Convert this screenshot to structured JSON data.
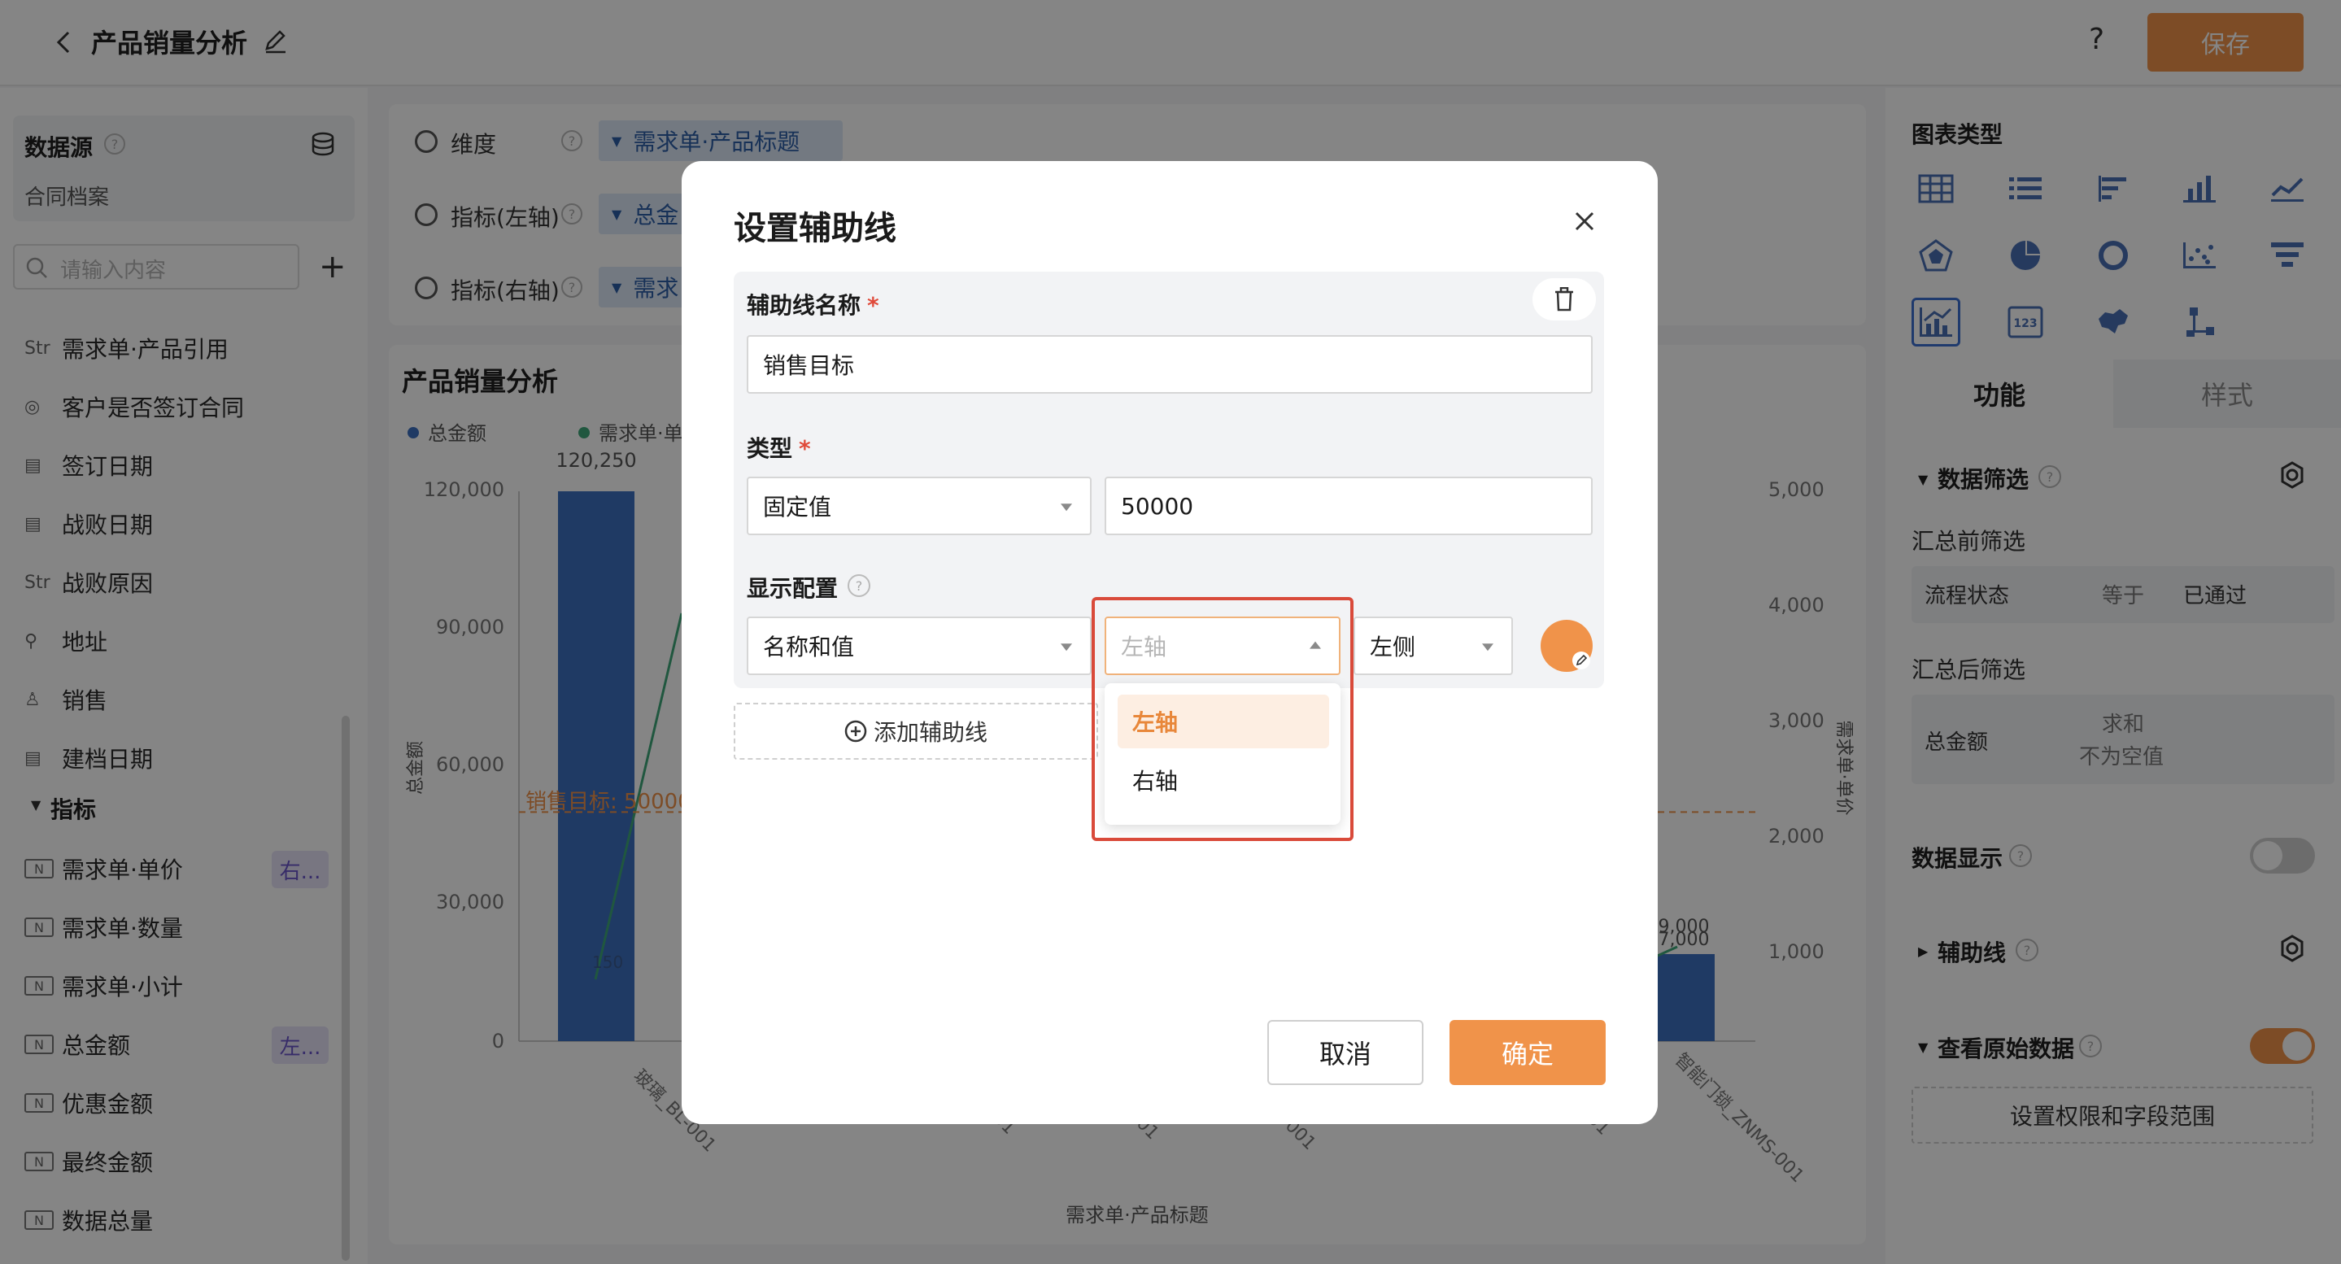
{
  "header": {
    "title": "产品销量分析",
    "help": "?",
    "save_label": "保存"
  },
  "datasource": {
    "title": "数据源",
    "help": "?",
    "name": "合同档案",
    "search_placeholder": "请输入内容",
    "fields": [
      {
        "icon": "Str",
        "label": "需求单·产品引用"
      },
      {
        "icon": "◎",
        "label": "客户是否签订合同"
      },
      {
        "icon": "▤",
        "label": "签订日期"
      },
      {
        "icon": "▤",
        "label": "战败日期"
      },
      {
        "icon": "Str",
        "label": "战败原因"
      },
      {
        "icon": "⚲",
        "label": "地址"
      },
      {
        "icon": "♙",
        "label": "销售"
      },
      {
        "icon": "▤",
        "label": "建档日期"
      }
    ],
    "metric_section": "指标",
    "metrics": [
      {
        "label": "需求单·单价",
        "badge": "右..."
      },
      {
        "label": "需求单·数量",
        "badge": ""
      },
      {
        "label": "需求单·小计",
        "badge": ""
      },
      {
        "label": "总金额",
        "badge": "左..."
      },
      {
        "label": "优惠金额",
        "badge": ""
      },
      {
        "label": "最终金额",
        "badge": ""
      },
      {
        "label": "数据总量",
        "badge": ""
      }
    ]
  },
  "config_rows": [
    {
      "label": "维度",
      "tag": "需求单·产品标题"
    },
    {
      "label": "指标(左轴)",
      "tag": "总金"
    },
    {
      "label": "指标(右轴)",
      "tag": "需求"
    }
  ],
  "chart": {
    "title": "产品销量分析",
    "legend": [
      "总金额",
      "需求单·单"
    ],
    "top_label": "120,250",
    "left_ticks": [
      "120,000",
      "90,000",
      "60,000",
      "30,000",
      "0"
    ],
    "right_ticks": [
      "5,000",
      "4,000",
      "3,000",
      "2,000",
      "1,000"
    ],
    "left_axis_title": "总金额",
    "right_axis_title": "需求单·单价",
    "x_axis_title": "需求单·产品标题",
    "x_labels": [
      "玻璃_BL-001",
      "001",
      "DZYJ-001",
      "SQ-001",
      "LYYX-001",
      "001",
      "SLKL-001",
      "智能门锁_ZNMS-001"
    ],
    "aux_label": "销售目标: 50000",
    "bar_partial_labels": [
      "9,000",
      "7,000"
    ],
    "line_point_label": "150",
    "colors": {
      "bar": "#3d6fc0",
      "line": "#3ea87a",
      "aux": "#f0934a"
    }
  },
  "chart_data": {
    "type": "bar",
    "title": "产品销量分析",
    "xlabel": "需求单·产品标题",
    "ylabel": "总金额",
    "ylim": [
      0,
      120000
    ],
    "y2label": "需求单·单价",
    "y2lim": [
      0,
      5000
    ],
    "categories": [
      "玻璃_BL-001",
      "智能门锁_ZNMS-001"
    ],
    "series": [
      {
        "name": "总金额",
        "values": [
          120250,
          19000
        ]
      }
    ],
    "reference_line": {
      "name": "销售目标",
      "value": 50000
    }
  },
  "right_panel": {
    "chart_type_title": "图表类型",
    "chart_type_icons": [
      "table-icon",
      "list-icon",
      "bar-horizontal-icon",
      "bar-icon",
      "line-icon",
      "radar-icon",
      "pie-icon",
      "ring-icon",
      "scatter-icon",
      "funnel-icon",
      "combo-chart-icon",
      "number-card-icon",
      "map-icon",
      "tree-icon"
    ],
    "tab_func": "功能",
    "tab_style": "样式",
    "data_filter": "数据筛选",
    "pre_filter": "汇总前筛选",
    "pre_filter_field": "流程状态",
    "pre_filter_op": "等于",
    "pre_filter_value": "已通过",
    "post_filter": "汇总后筛选",
    "post_filter_field": "总金额",
    "post_filter_op_line1": "求和",
    "post_filter_op_line2": "不为空值",
    "data_display": "数据显示",
    "aux_line": "辅助线",
    "view_raw": "查看原始数据",
    "perm_button": "设置权限和字段范围"
  },
  "modal": {
    "title": "设置辅助线",
    "name_label": "辅助线名称",
    "name_value": "销售目标",
    "type_label": "类型",
    "type_value": "固定值",
    "fixed_value": "50000",
    "display_label": "显示配置",
    "display_value": "名称和值",
    "axis_placeholder": "左轴",
    "side_value": "左侧",
    "axis_options": [
      "左轴",
      "右轴"
    ],
    "add_label": "添加辅助线",
    "cancel": "取消",
    "ok": "确定",
    "required_mark": "*",
    "help": "?"
  }
}
